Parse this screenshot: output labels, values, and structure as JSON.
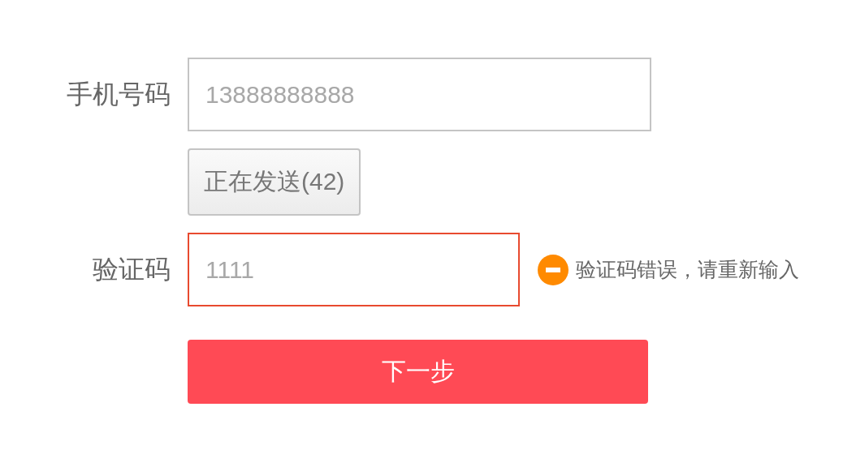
{
  "phone": {
    "label": "手机号码",
    "value": "13888888888"
  },
  "send_button": {
    "label": "正在发送(42)"
  },
  "code": {
    "label": "验证码",
    "value": "1111",
    "error": true,
    "error_message": "验证码错误，请重新输入"
  },
  "next_button": {
    "label": "下一步"
  }
}
